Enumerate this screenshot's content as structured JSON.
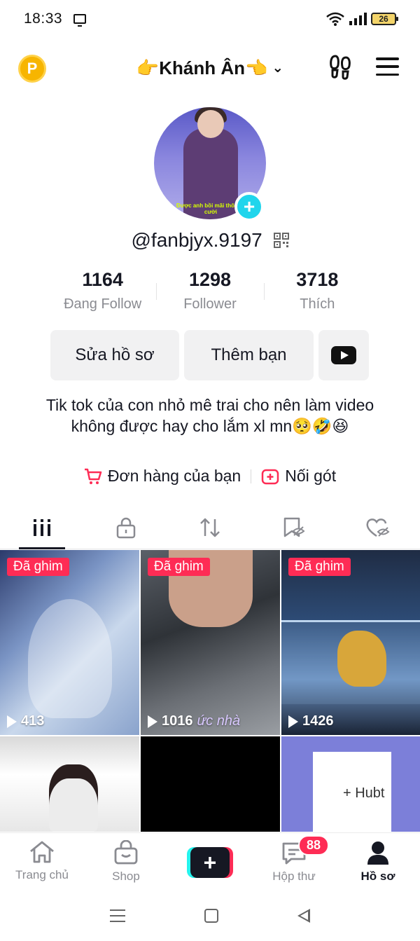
{
  "status_bar": {
    "time": "18:33",
    "battery": "26",
    "icons": [
      "screen-mirror-icon",
      "wifi-icon",
      "signal-icon",
      "battery-icon"
    ]
  },
  "top_nav": {
    "coin_icon_letter": "P",
    "username": "👉Khánh Ân👈",
    "icons": [
      "coin-icon",
      "chevron-down-icon",
      "footprints-icon",
      "menu-icon"
    ]
  },
  "profile": {
    "avatar_caption": "Được anh bồi mãi thôi Nụ cười",
    "handle": "@fanbjyx.9197",
    "stats": [
      {
        "value": "1164",
        "label": "Đang Follow"
      },
      {
        "value": "1298",
        "label": "Follower"
      },
      {
        "value": "3718",
        "label": "Thích"
      }
    ],
    "buttons": {
      "edit": "Sửa hồ sơ",
      "add_friend": "Thêm bạn"
    },
    "bio": "Tik tok của con nhỏ mê trai cho nên làm video không được hay cho lắm xl mn🥺🤣😆",
    "links": {
      "orders": "Đơn hàng của bạn",
      "streak": "Nối gót"
    }
  },
  "tabs": [
    "videos-grid-icon",
    "private-lock-icon",
    "repost-icon",
    "saved-icon",
    "liked-icon"
  ],
  "videos": [
    {
      "pinned": "Đã ghim",
      "views": "413"
    },
    {
      "pinned": "Đã ghim",
      "views": "1016"
    },
    {
      "pinned": "Đã ghim",
      "views": "1426"
    },
    {
      "pinned": "",
      "views": ""
    },
    {
      "pinned": "",
      "views": ""
    },
    {
      "pinned": "",
      "views": ""
    }
  ],
  "tile_text": {
    "tile2_overlay": "ức nhà",
    "tile6_note": "+ Hubt"
  },
  "bottom_nav": {
    "home": "Trang chủ",
    "shop": "Shop",
    "create": "+",
    "inbox": "Hộp thư",
    "inbox_badge": "88",
    "profile": "Hồ sơ"
  },
  "colors": {
    "accent": "#fe2c55",
    "cyan": "#20d5ec",
    "text": "#161823",
    "muted": "#8a8b91"
  }
}
